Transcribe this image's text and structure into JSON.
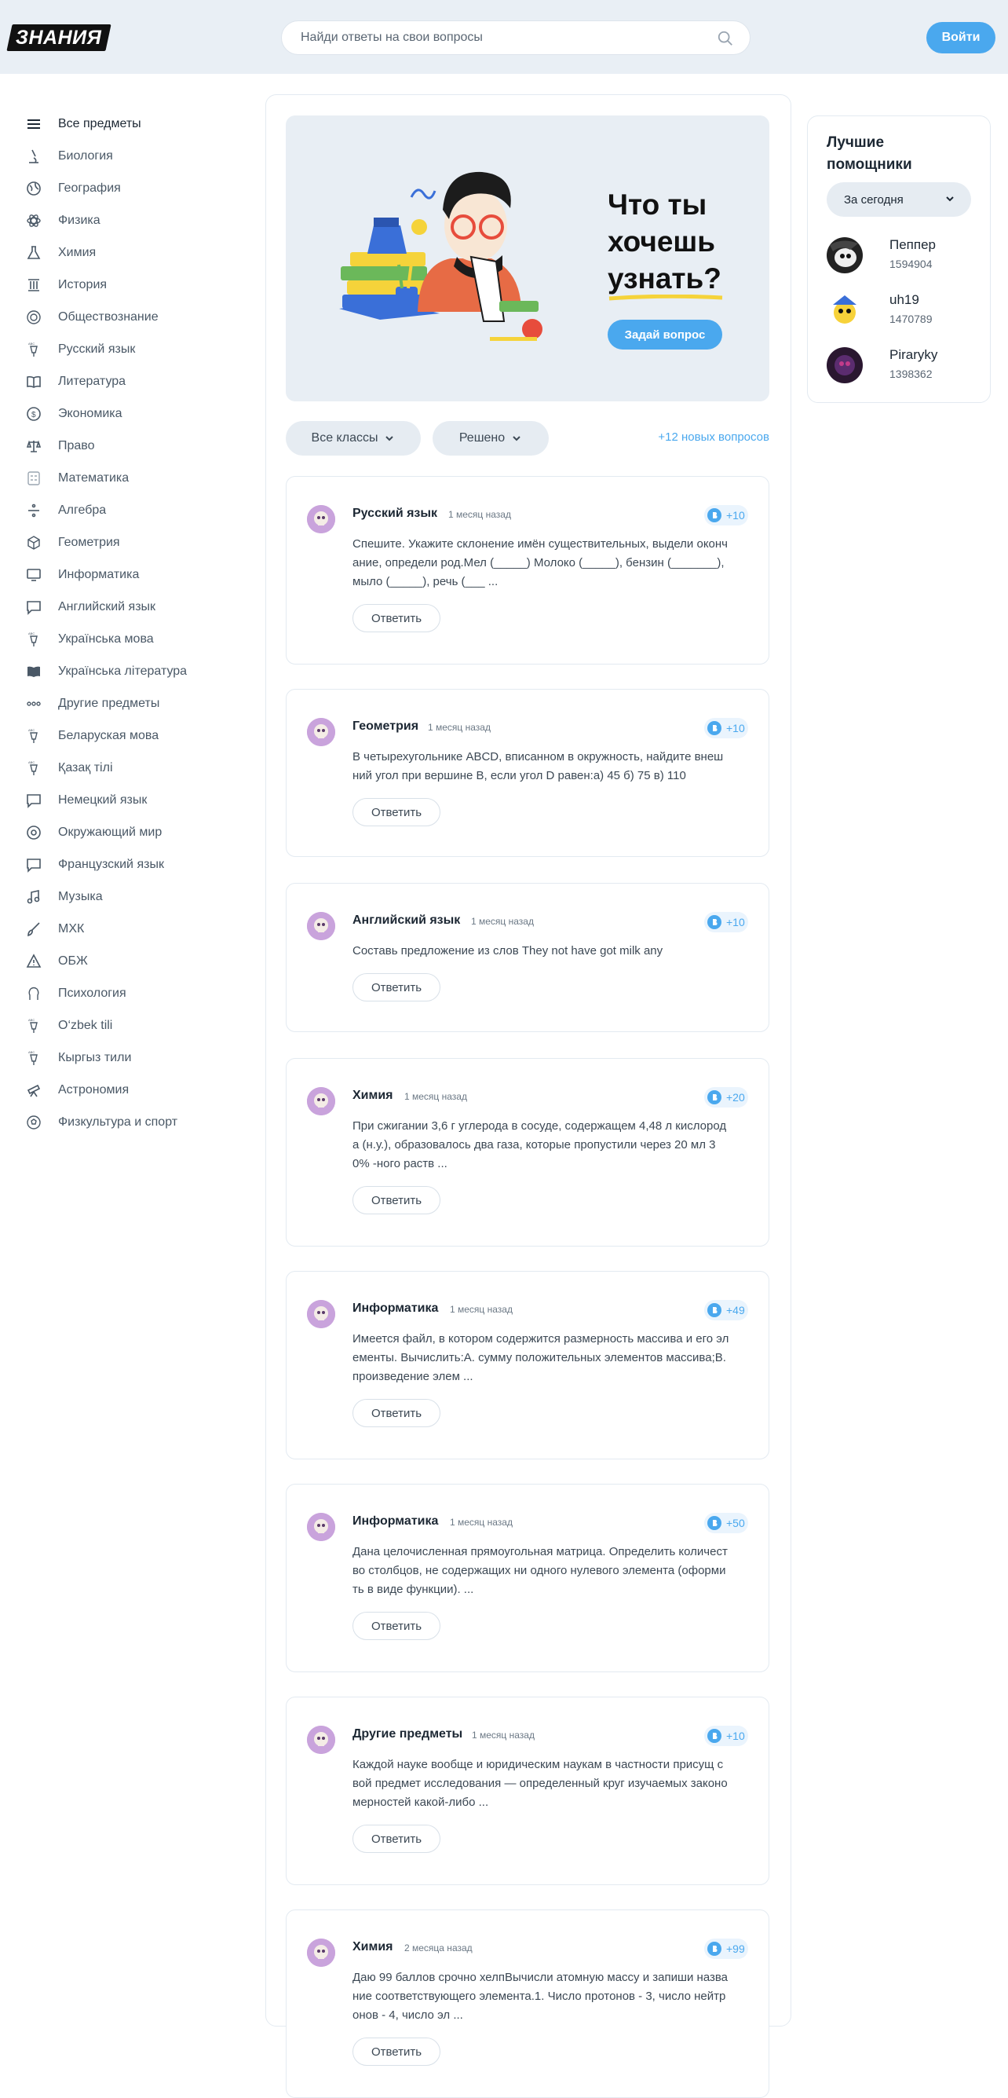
{
  "header": {
    "logo": "ЗНАНИЯ",
    "search_placeholder": "Найди ответы на свои вопросы",
    "login_label": "Войти"
  },
  "sidebar": {
    "items": [
      {
        "label": "Все предметы",
        "icon": "menu-icon"
      },
      {
        "label": "Биология",
        "icon": "microscope-icon"
      },
      {
        "label": "География",
        "icon": "globe-icon"
      },
      {
        "label": "Физика",
        "icon": "atom-icon"
      },
      {
        "label": "Химия",
        "icon": "flask-icon"
      },
      {
        "label": "История",
        "icon": "column-icon"
      },
      {
        "label": "Обществознание",
        "icon": "society-icon"
      },
      {
        "label": "Русский язык",
        "icon": "language-pen-icon"
      },
      {
        "label": "Литература",
        "icon": "book-icon"
      },
      {
        "label": "Экономика",
        "icon": "coin-icon"
      },
      {
        "label": "Право",
        "icon": "scales-icon"
      },
      {
        "label": "Математика",
        "icon": "calculator-icon"
      },
      {
        "label": "Алгебра",
        "icon": "division-icon"
      },
      {
        "label": "Геометрия",
        "icon": "cube-icon"
      },
      {
        "label": "Информатика",
        "icon": "monitor-icon"
      },
      {
        "label": "Английский язык",
        "icon": "speech-en-icon"
      },
      {
        "label": "Українська мова",
        "icon": "language-pen-icon"
      },
      {
        "label": "Українська література",
        "icon": "book-filled-icon"
      },
      {
        "label": "Другие предметы",
        "icon": "dots-icon"
      },
      {
        "label": "Беларуская мова",
        "icon": "language-pen-icon"
      },
      {
        "label": "Қазақ тілі",
        "icon": "language-pen-icon"
      },
      {
        "label": "Немецкий язык",
        "icon": "speech-de-icon"
      },
      {
        "label": "Окружающий мир",
        "icon": "world-icon"
      },
      {
        "label": "Французский язык",
        "icon": "speech-fr-icon"
      },
      {
        "label": "Музыка",
        "icon": "music-icon"
      },
      {
        "label": "МХК",
        "icon": "brush-icon"
      },
      {
        "label": "ОБЖ",
        "icon": "warning-icon"
      },
      {
        "label": "Психология",
        "icon": "psychology-icon"
      },
      {
        "label": "O‘zbek tili",
        "icon": "language-pen-icon"
      },
      {
        "label": "Кыргыз тили",
        "icon": "language-pen-icon"
      },
      {
        "label": "Астрономия",
        "icon": "telescope-icon"
      },
      {
        "label": "Физкультура и спорт",
        "icon": "ball-icon"
      }
    ]
  },
  "hero": {
    "title": "Что ты хочешь узнать?",
    "ask_label": "Задай вопрос"
  },
  "filters": {
    "classes_label": "Все классы",
    "status_label": "Решено",
    "new_questions": "+12 новых вопросов"
  },
  "questions": [
    {
      "subject": "Русский язык",
      "time": "1 месяц назад",
      "points": "+10",
      "text": "Спешите. Укажите склонение имён существительных, выдели окончание, определи род.Мел (_____) Молоко (_____), бензин (_______), мыло (_____), речь (___ ...",
      "answer_label": "Ответить"
    },
    {
      "subject": "Геометрия",
      "time": "1 месяц назад",
      "points": "+10",
      "text": "В четырехугольнике ABCD, вписанном в окружность, найдите внешний угол при вершине B, если угол D равен:а) 45 б) 75 в) 110",
      "answer_label": "Ответить"
    },
    {
      "subject": "Английский язык",
      "time": "1 месяц назад",
      "points": "+10",
      "text": "Составь предложение из слов They not have got milk any",
      "answer_label": "Ответить"
    },
    {
      "subject": "Химия",
      "time": "1 месяц назад",
      "points": "+20",
      "text": "При сжигании 3,6 г углерода в сосуде, содержащем 4,48 л кислорода (н.у.), образовалось два газа, которые пропустили через 20 мл 30% -ного раств ...",
      "answer_label": "Ответить"
    },
    {
      "subject": "Информатика",
      "time": "1 месяц назад",
      "points": "+49",
      "text": "Имеется файл, в котором содержится размерность массива и его элементы. Вычислить:А. сумму положительных элементов массива;В. произведение элем ...",
      "answer_label": "Ответить"
    },
    {
      "subject": "Информатика",
      "time": "1 месяц назад",
      "points": "+50",
      "text": "Дана целочисленная прямоугольная матрица. Определить количество столбцов, не содержащих ни одного нулевого элемента (оформить в виде функции). ...",
      "answer_label": "Ответить"
    },
    {
      "subject": "Другие предметы",
      "time": "1 месяц назад",
      "points": "+10",
      "text": "Каждой науке вообще и юридическим наукам в частности присущ свой предмет исследования — определенный круг изучаемых закономерностей какой-либо ...",
      "answer_label": "Ответить"
    },
    {
      "subject": "Химия",
      "time": "2 месяца назад",
      "points": "+99",
      "text": "Даю 99 баллов срочно хелпВычисли атомную массу и запиши название соответствующего элемента.1. Число протонов - 3, число нейтронов - 4, число эл ...",
      "answer_label": "Ответить"
    }
  ],
  "helpers": {
    "title": "Лучшие помощники",
    "period": "За сегодня",
    "list": [
      {
        "name": "Пеппер",
        "score": "1594904"
      },
      {
        "name": "uh19",
        "score": "1470789"
      },
      {
        "name": "Pirаryky",
        "score": "1398362"
      }
    ]
  },
  "colors": {
    "accent": "#4aa8ee",
    "header_bg": "#e9eff5",
    "hero_bg": "#e8eef4"
  }
}
